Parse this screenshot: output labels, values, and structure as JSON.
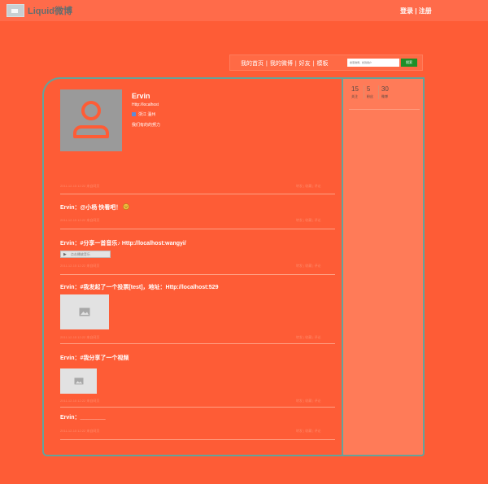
{
  "header": {
    "logo_text": "Liquid微博",
    "login": "登录",
    "separator": "|",
    "register": "注册"
  },
  "nav": {
    "items": [
      "我的首页",
      "我的微博",
      "好友",
      "模板"
    ],
    "separator": "|",
    "search_placeholder": "搜索微博、找到用户",
    "search_button": "搜索"
  },
  "profile": {
    "name": "Ervin",
    "url": "Http://localhost",
    "location": "浙江 温州",
    "description": "我们有的的努力"
  },
  "stats": [
    {
      "num": "15",
      "label": "关注"
    },
    {
      "num": "5",
      "label": "粉丝"
    },
    {
      "num": "30",
      "label": "微博"
    }
  ],
  "feed": {
    "meta_left": "2011-12-15 12:22 来自网页",
    "meta_right": "转发 | 收藏 | 评论",
    "posts": [
      {
        "author": "Ervin",
        "text": "：@小杨 快看吧！"
      },
      {
        "author": "Ervin",
        "text": "：#分享一首音乐♪ Http://localhost:wangyi/",
        "music_label": "点击播放音乐"
      },
      {
        "author": "Ervin",
        "text": "：#我发起了一个投票[test]，地址：Http://localhost:529"
      },
      {
        "author": "Ervin",
        "text": "：#我分享了一个视频"
      },
      {
        "author": "Ervin",
        "text": "：________"
      }
    ]
  },
  "colors": {
    "background": "#fe5c36",
    "border": "#64a39b",
    "sidebar": "#ff7b58",
    "search_button": "#1e8f29"
  }
}
